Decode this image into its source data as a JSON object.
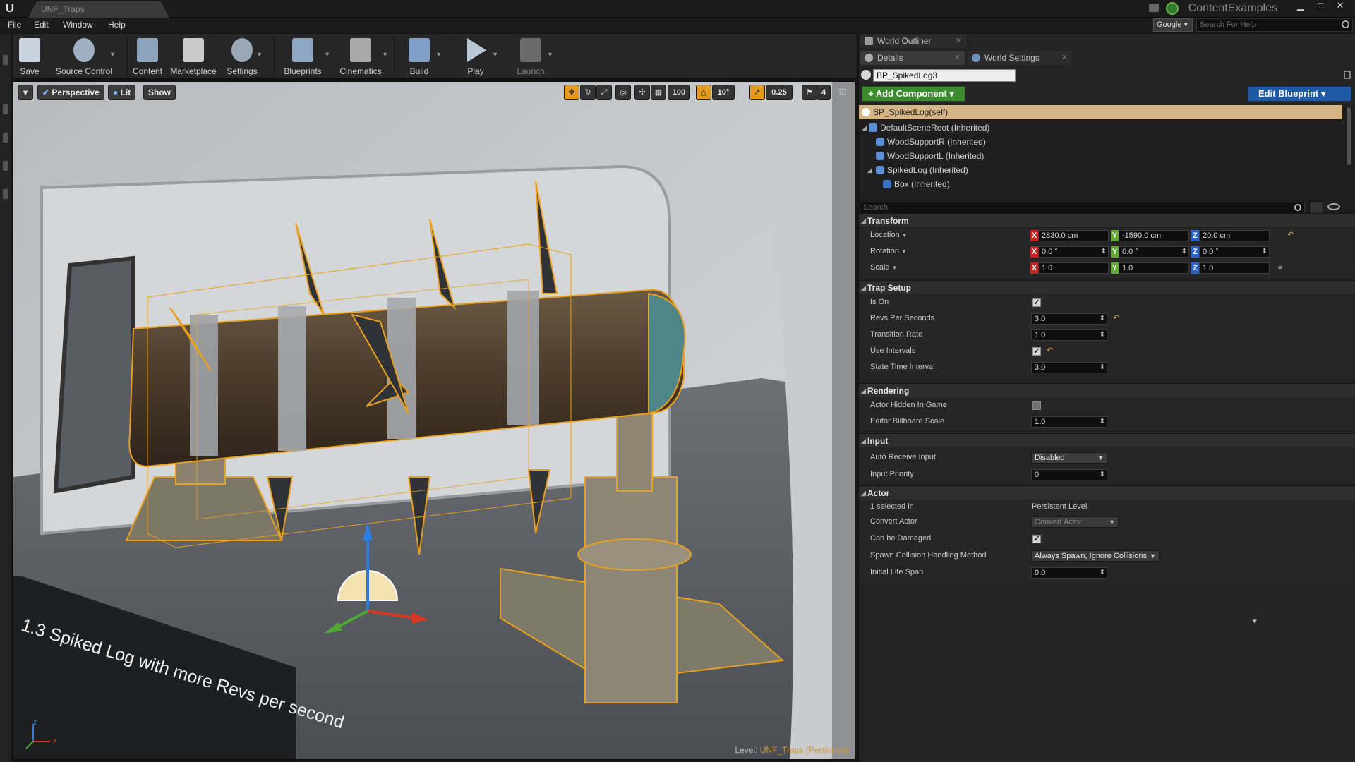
{
  "window": {
    "doc_tab": "UNF_Traps",
    "project": "ContentExamples",
    "minimize": "▁",
    "maximize": "□",
    "close": "✕"
  },
  "menu": [
    "File",
    "Edit",
    "Window",
    "Help"
  ],
  "help_search": {
    "provider": "Google ▾",
    "placeholder": "Search For Help"
  },
  "toolbar": {
    "save": "Save",
    "source_control": "Source Control",
    "content": "Content",
    "marketplace": "Marketplace",
    "settings": "Settings",
    "blueprints": "Blueprints",
    "cinematics": "Cinematics",
    "build": "Build",
    "play": "Play",
    "launch": "Launch"
  },
  "viewport": {
    "perspective": "Perspective",
    "lit": "Lit",
    "show": "Show",
    "grid_snap": "100",
    "rotation_snap": "10°",
    "scale_snap": "0.25",
    "camera_speed": "4",
    "level_prefix": "Level:",
    "level_name": "UNF_Traps (Persistent)",
    "sign_text": "1.3 Spiked Log with more Revs per second",
    "axis_z": "z",
    "axis_x": "x"
  },
  "panels": {
    "world_outliner": "World Outliner",
    "details": "Details",
    "world_settings": "World Settings"
  },
  "details": {
    "actor_name": "BP_SpikedLog3",
    "add_component": "+ Add Component ▾",
    "edit_blueprint": "Edit Blueprint ▾",
    "components": [
      "BP_SpikedLog(self)",
      "DefaultSceneRoot (Inherited)",
      "WoodSupportR (Inherited)",
      "WoodSupportL (Inherited)",
      "SpikedLog (Inherited)",
      "Box (Inherited)"
    ],
    "search_placeholder": "Search",
    "transform": {
      "header": "Transform",
      "location_label": "Location",
      "rotation_label": "Rotation",
      "scale_label": "Scale",
      "location": [
        "2830.0 cm",
        "-1590.0 cm",
        "20.0 cm"
      ],
      "rotation": [
        "0.0 °",
        "0.0 °",
        "0.0 °"
      ],
      "scale": [
        "1.0",
        "1.0",
        "1.0"
      ]
    },
    "trap_setup": {
      "header": "Trap Setup",
      "is_on_label": "Is On",
      "revs_label": "Revs Per Seconds",
      "revs": "3.0",
      "transition_label": "Transition Rate",
      "transition": "1.0",
      "intervals_label": "Use Intervals",
      "state_time_label": "State Time Interval",
      "state_time": "3.0"
    },
    "rendering": {
      "header": "Rendering",
      "hidden_label": "Actor Hidden In Game",
      "billboard_label": "Editor Billboard Scale",
      "billboard": "1.0"
    },
    "input": {
      "header": "Input",
      "auto_receive_label": "Auto Receive Input",
      "auto_receive": "Disabled",
      "priority_label": "Input Priority",
      "priority": "0"
    },
    "actor": {
      "header": "Actor",
      "selected_label": "1 selected in",
      "selected_value": "Persistent Level",
      "convert_label": "Convert Actor",
      "convert_value": "Convert Actor",
      "damaged_label": "Can be Damaged",
      "spawn_label": "Spawn Collision Handling Method",
      "spawn_value": "Always Spawn, Ignore Collisions",
      "life_label": "Initial Life Span",
      "life_value": "0.0"
    }
  },
  "colors": {
    "selection_orange": "#e8a020",
    "add_component_green": "#3b8a2e",
    "edit_blueprint_blue": "#1f58a3",
    "selected_row": "#d6b585"
  }
}
